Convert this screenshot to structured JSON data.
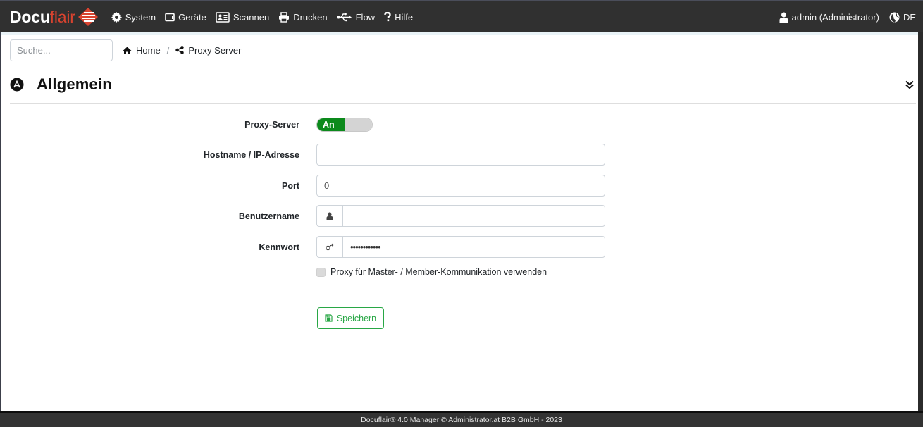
{
  "navbar": {
    "logo": {
      "part1": "Docu",
      "part2": "flair",
      "brand_color": "#d9432f"
    },
    "items": [
      {
        "label": "System",
        "icon": "gear-icon"
      },
      {
        "label": "Geräte",
        "icon": "device-icon"
      },
      {
        "label": "Scannen",
        "icon": "id-card-icon"
      },
      {
        "label": "Drucken",
        "icon": "printer-icon"
      },
      {
        "label": "Flow",
        "icon": "usb-icon"
      },
      {
        "label": "Hilfe",
        "icon": "question-icon"
      }
    ],
    "user": {
      "label": "admin (Administrator)",
      "icon": "user-icon"
    },
    "language": {
      "label": "DE",
      "icon": "globe-icon"
    }
  },
  "search": {
    "placeholder": "Suche...",
    "value": ""
  },
  "breadcrumb": {
    "home": {
      "label": "Home",
      "icon": "home-icon"
    },
    "separator": "/",
    "current": {
      "label": "Proxy Server",
      "icon": "share-icon"
    }
  },
  "section": {
    "title": "Allgemein",
    "icon": "section-logo-icon",
    "collapse_icon": "chevrons-down-icon"
  },
  "form": {
    "proxy_server": {
      "label": "Proxy-Server",
      "toggle_text": "An",
      "enabled": true,
      "on_color": "#0c8a1c"
    },
    "hostname": {
      "label": "Hostname / IP-Adresse",
      "value": ""
    },
    "port": {
      "label": "Port",
      "value": "0"
    },
    "username": {
      "label": "Benutzername",
      "value": "",
      "icon": "user-icon"
    },
    "password": {
      "label": "Kennwort",
      "value": "••••••••••••",
      "icon": "key-icon"
    },
    "master_member": {
      "label": "Proxy für Master- / Member-Kommunikation verwenden",
      "checked": false
    },
    "save": {
      "label": "Speichern",
      "icon": "save-icon",
      "color": "#28a745"
    }
  },
  "footer": {
    "text": "Docuflair® 4.0 Manager © Administrator.at B2B GmbH - 2023"
  }
}
